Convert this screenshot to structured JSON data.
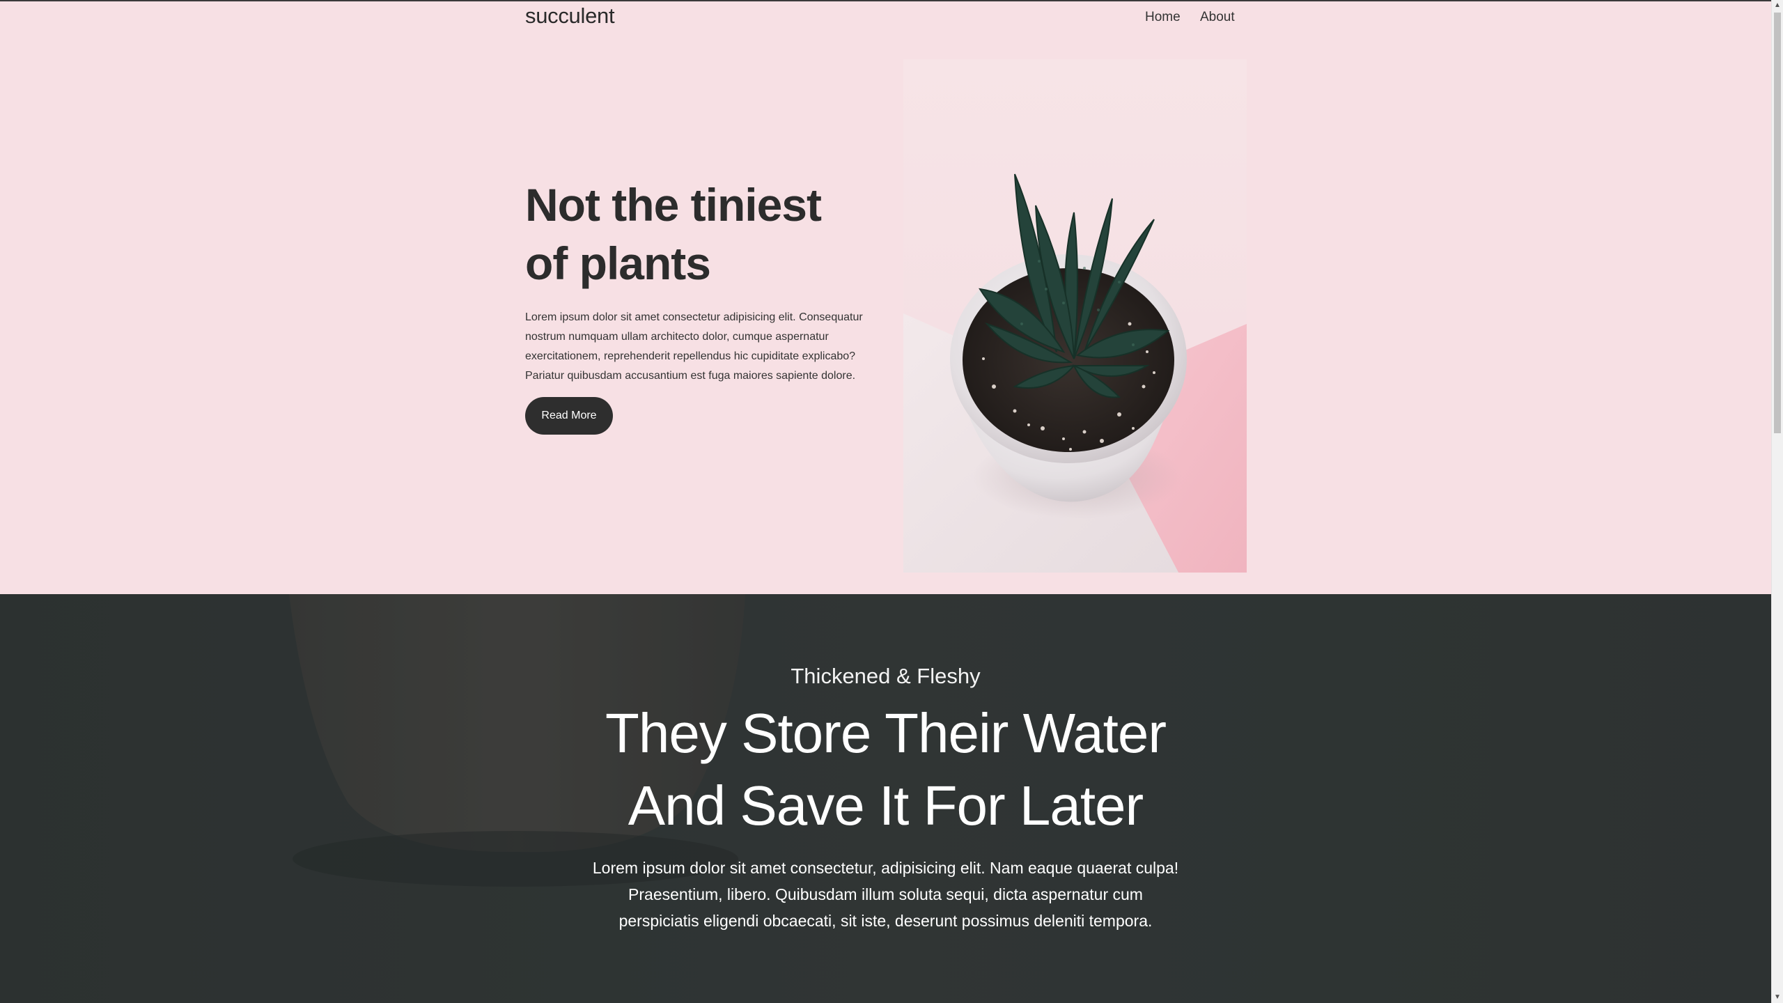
{
  "nav": {
    "brand": "succulent",
    "links": [
      "Home",
      "About"
    ]
  },
  "hero": {
    "title": "Not the tiniest of plants",
    "body": "Lorem ipsum dolor sit amet consectetur adipisicing elit. Consequatur nostrum numquam ullam architecto dolor, cumque aspernatur exercitationem, reprehenderit repellendus hic cupiditate explicabo? Pariatur quibusdam accusantium est fuga maiores sapiente dolore.",
    "button": "Read More"
  },
  "feature": {
    "kicker": "Thickened & Fleshy",
    "title": "They Store Their Water And Save It For Later",
    "body": "Lorem ipsum dolor sit amet consectetur, adipisicing elit. Nam eaque quaerat culpa! Praesentium, libero. Quibusdam illum soluta sequi, dicta aspernatur cum perspiciatis eligendi obcaecati, sit iste, deserunt possimus deleniti tempora."
  },
  "colors": {
    "hero_bg": "#f7e0e4",
    "dark_section_bg": "#333837",
    "button_bg": "#2e2e2e",
    "text_dark": "#2c2c2c"
  }
}
